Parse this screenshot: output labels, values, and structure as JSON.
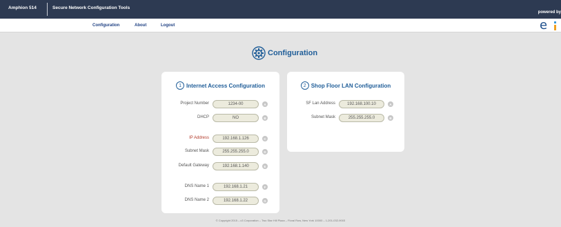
{
  "topbar": {
    "brand": "Amphion 514",
    "app_title": "Secure Network Configuration Tools",
    "powered_by": "powered by"
  },
  "nav": {
    "configuration": "Configuration",
    "about": "About",
    "logout": "Logout"
  },
  "page": {
    "title": "Configuration"
  },
  "internet": {
    "number": "1",
    "title": "Internet Access Configuration",
    "fields": [
      {
        "label": "Project Number",
        "value": "1234-00",
        "badge": "A"
      },
      {
        "label": "DHCP",
        "value": "NO",
        "badge": "B"
      },
      {
        "label": "IP Address",
        "value": "192.168.1.126",
        "badge": "C"
      },
      {
        "label": "Subnet Mask",
        "value": "255.255.255.0",
        "badge": "D"
      },
      {
        "label": "Default Gateway",
        "value": "192.168.1.140",
        "badge": "E"
      },
      {
        "label": "DNS Name 1",
        "value": "192.168.1.21",
        "badge": "F"
      },
      {
        "label": "DNS Name 2",
        "value": "192.168.1.22",
        "badge": "G"
      }
    ]
  },
  "lan": {
    "number": "2",
    "title": "Shop Floor LAN Configuration",
    "fields": [
      {
        "label": "SF Lan Address",
        "value": "192.168.100.10",
        "badge": "A"
      },
      {
        "label": "Subnet Mask",
        "value": "255.255.255.0",
        "badge": "B"
      }
    ]
  },
  "footer": {
    "text": "© Copyright 2015 – c3 Corporation – Two Star Hill Plaza – Floral Row, New York 10000 – 1-201-032-9003"
  },
  "colors": {
    "topbar": "#2d3a52",
    "accent": "#1f5d98",
    "field_bg": "#ecebdd",
    "ip_label": "#b23a2a"
  }
}
